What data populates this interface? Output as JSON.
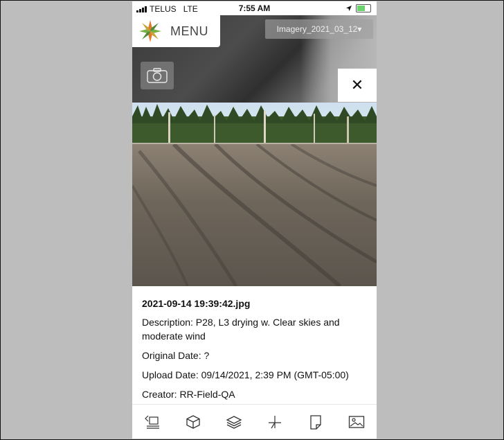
{
  "status_bar": {
    "carrier": "TELUS",
    "network": "LTE",
    "time": "7:55 AM"
  },
  "header": {
    "menu_label": "MENU",
    "imagery_label": "Imagery_2021_03_12▾"
  },
  "icons": {
    "logo": "star-compass-logo",
    "camera": "camera-icon",
    "close": "close-icon",
    "toolbar": [
      "measure-icon",
      "cube-icon",
      "layers-icon",
      "crosshair-icon",
      "note-icon",
      "image-icon"
    ]
  },
  "close_glyph": "✕",
  "photo": {
    "filename": "2021-09-14 19:39:42.jpg",
    "description": "Description: P28, L3 drying w. Clear skies and moderate wind",
    "original_date": "Original Date: ?",
    "upload_date": "Upload Date: 09/14/2021, 2:39 PM (GMT-05:00)",
    "creator": "Creator: RR-Field-QA"
  },
  "colors": {
    "page_background": "#bdbdbd",
    "accent_orange": "#e0772a",
    "accent_green": "#79b043"
  }
}
